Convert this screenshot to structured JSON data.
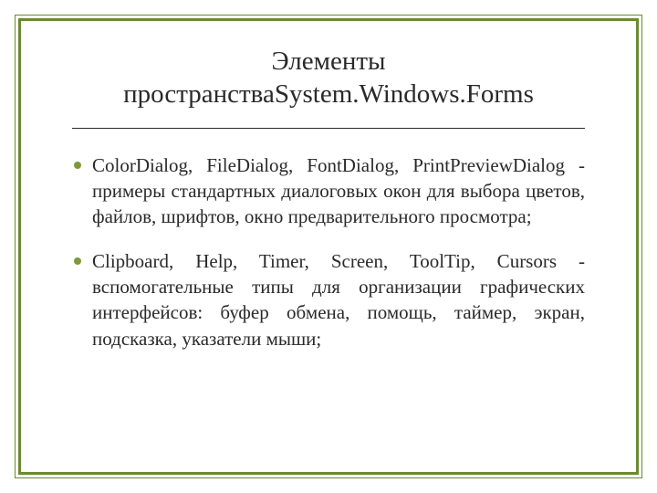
{
  "slide": {
    "title": "Элементы пространстваSystem.Windows.Forms",
    "bullets": [
      "ColorDialog, FileDialog, FontDialog, PrintPreviewDialog - примеры стандартных диалоговых окон для выбора цветов, файлов, шрифтов, окно предварительного просмотра;",
      "Clipboard, Help, Timer, Screen, ToolTip, Cursors - вспомогательные типы для организации графических интерфейсов: буфер обмена, помощь, таймер, экран, подсказка, указатели мыши;"
    ]
  },
  "colors": {
    "border": "#6a8a30",
    "bullet": "#7b9b3a",
    "text": "#2a2a2a"
  }
}
